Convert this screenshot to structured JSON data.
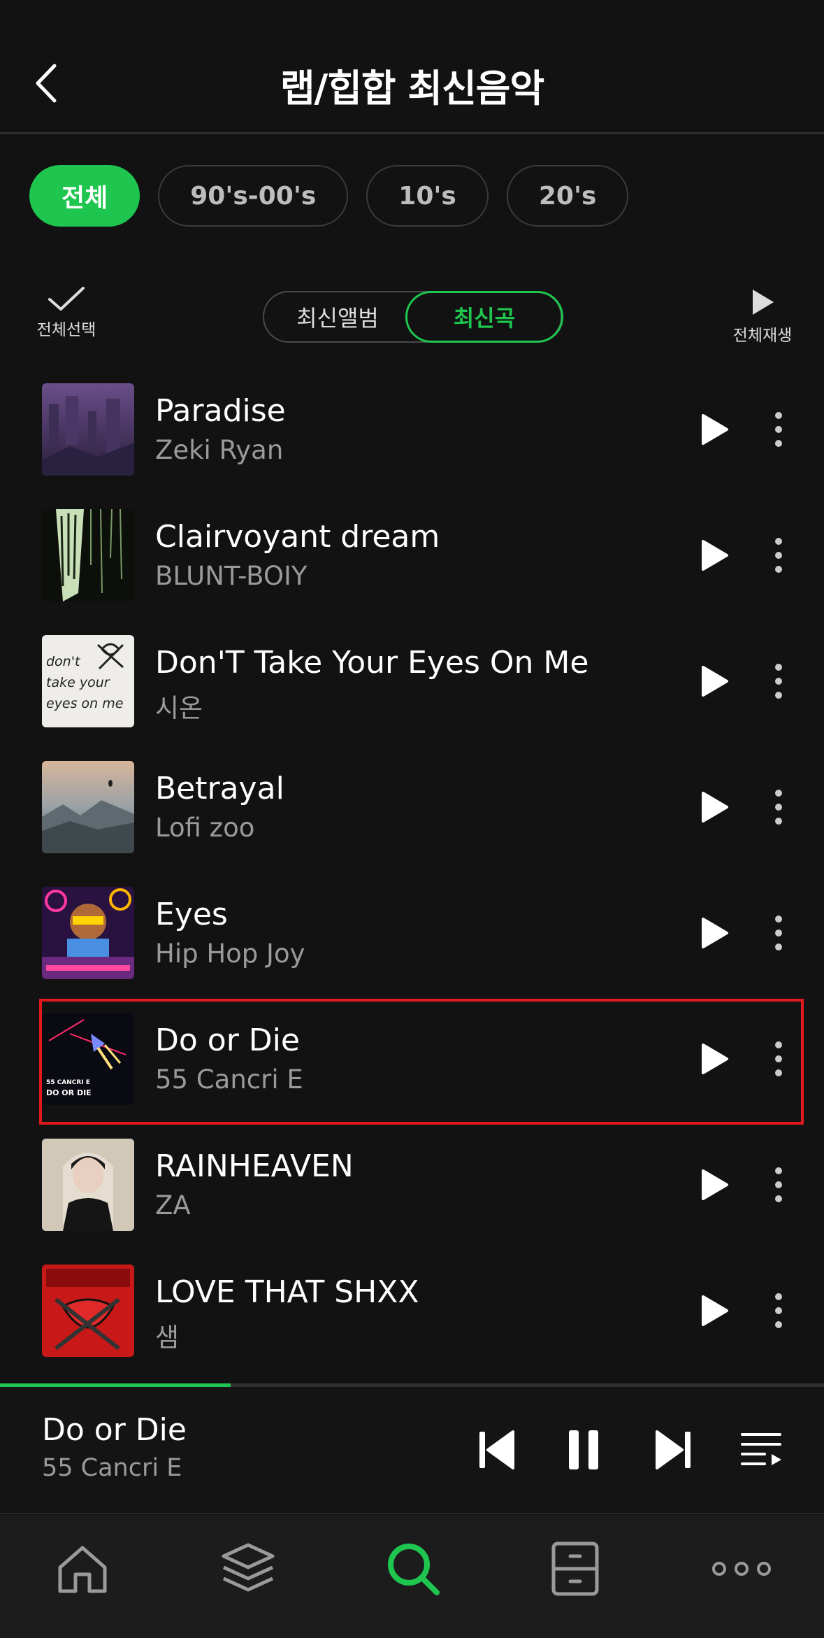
{
  "header": {
    "title": "랩/힙합 최신음악"
  },
  "filters": {
    "chips": [
      {
        "label": "전체",
        "active": true
      },
      {
        "label": "90's-00's",
        "active": false
      },
      {
        "label": "10's",
        "active": false
      },
      {
        "label": "20's",
        "active": false
      }
    ]
  },
  "toolbar": {
    "select_all_label": "전체선택",
    "segment": {
      "album_label": "최신앨범",
      "song_label": "최신곡",
      "selected": "최신곡"
    },
    "play_all_label": "전체재생"
  },
  "songs": [
    {
      "title": "Paradise",
      "artist": "Zeki Ryan",
      "art": "purple-ruins"
    },
    {
      "title": "Clairvoyant dream",
      "artist": "BLUNT-BOIY",
      "art": "dark-drips"
    },
    {
      "title": "Don'T Take Your Eyes On Me",
      "artist": "시온",
      "art": "handwriting",
      "art_text": [
        "don't",
        "take your",
        "eyes on me"
      ]
    },
    {
      "title": "Betrayal",
      "artist": "Lofi zoo",
      "art": "mountain-sunset"
    },
    {
      "title": "Eyes",
      "artist": "Hip Hop Joy",
      "art": "neon-bear"
    },
    {
      "title": "Do or Die",
      "artist": "55 Cancri E",
      "art": "space-ship",
      "art_text": [
        "55 CANCRI E",
        "DO OR DIE"
      ],
      "highlighted": true
    },
    {
      "title": "RAINHEAVEN",
      "artist": "ZA",
      "art": "portrait"
    },
    {
      "title": "LOVE THAT SHXX",
      "artist": "샘",
      "art": "red-chains"
    }
  ],
  "now_playing": {
    "title": "Do or Die",
    "artist": "55 Cancri E",
    "progress": 0.28,
    "state": "playing"
  },
  "tabbar": {
    "tabs": [
      "home-icon",
      "library-icon",
      "search-icon",
      "storage-icon",
      "more-icon"
    ],
    "active": "search-icon"
  },
  "colors": {
    "accent": "#1ec64f",
    "highlight_border": "#e1191e",
    "background": "#121212"
  }
}
